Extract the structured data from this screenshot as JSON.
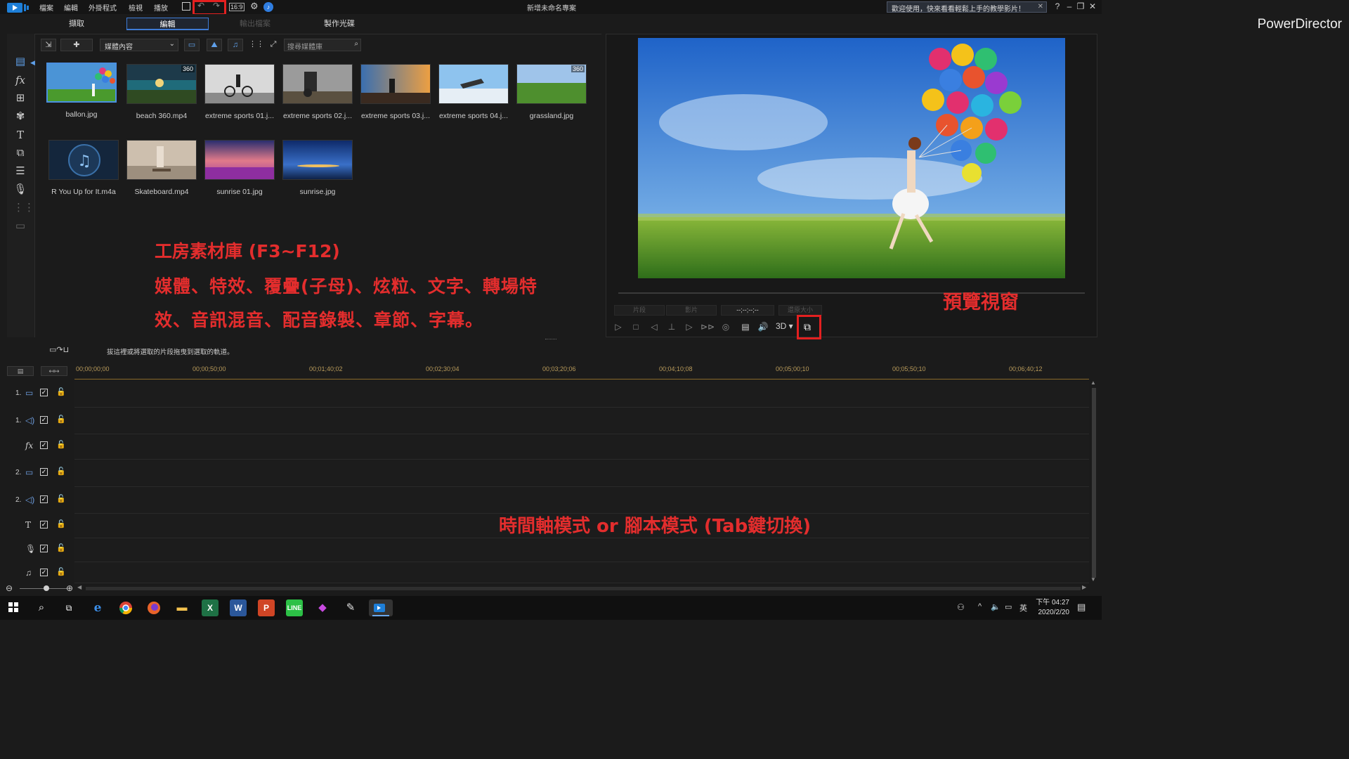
{
  "titlebar": {
    "menus": [
      "檔案",
      "編輯",
      "外掛程式",
      "檢視",
      "播放"
    ],
    "aspect": "16:9",
    "project_title": "新增未命名專案",
    "notice": "歡迎使用，快來看看輕鬆上手的教學影片！",
    "help": "?"
  },
  "modes": {
    "capture": "擷取",
    "edit": "編輯",
    "produce": "輸出檔案",
    "disc": "製作光碟"
  },
  "brand": "PowerDirector",
  "library": {
    "media_select": "媒體內容",
    "search_placeholder": "搜尋媒體庫",
    "items": [
      {
        "label": "ballon.jpg",
        "badge": ""
      },
      {
        "label": "beach 360.mp4",
        "badge": "360"
      },
      {
        "label": "extreme sports 01.j...",
        "badge": ""
      },
      {
        "label": "extreme sports 02.j...",
        "badge": ""
      },
      {
        "label": "extreme sports 03.j...",
        "badge": ""
      },
      {
        "label": "extreme sports 04.j...",
        "badge": ""
      },
      {
        "label": "grassland.jpg",
        "badge": "360"
      },
      {
        "label": "R You Up for It.m4a",
        "badge": ""
      },
      {
        "label": "Skateboard.mp4",
        "badge": ""
      },
      {
        "label": "sunrise 01.jpg",
        "badge": ""
      },
      {
        "label": "sunrise.jpg",
        "badge": ""
      }
    ]
  },
  "annotations": {
    "library_title": "工房素材庫 (F3~F12)",
    "library_line1": "媒體、特效、覆疊(子母)、炫粒、文字、轉場特",
    "library_line2": "效、音訊混音、配音錄製、章節、字幕。",
    "preview": "預覽視窗",
    "timeline": "時間軸模式 or 腳本模式 (Tab鍵切換)"
  },
  "preview": {
    "mode_clip": "片段",
    "mode_movie": "影片",
    "timecode": "--;--;--;--",
    "size": "還原大小",
    "btn_3d": "3D"
  },
  "timeline": {
    "hint": "拔這裡或將選取的片段拖曳到選取的軌道。",
    "ticks": [
      "00;00;00;00",
      "00;00;50;00",
      "00;01;40;02",
      "00;02;30;04",
      "00;03;20;06",
      "00;04;10;08",
      "00;05;00;10",
      "00;05;50;10",
      "00;06;40;12"
    ],
    "tracks": [
      {
        "num": "1.",
        "icon": "video"
      },
      {
        "num": "1.",
        "icon": "audio"
      },
      {
        "num": "",
        "icon": "fx"
      },
      {
        "num": "2.",
        "icon": "video"
      },
      {
        "num": "2.",
        "icon": "audio"
      },
      {
        "num": "",
        "icon": "title"
      },
      {
        "num": "",
        "icon": "voice"
      },
      {
        "num": "",
        "icon": "music"
      }
    ]
  },
  "taskbar": {
    "ime": "英",
    "time": "下午 04:27",
    "date": "2020/2/20"
  },
  "colors": {
    "accent": "#3e7bd6",
    "annotation_red": "#e32d2d",
    "background": "#1b1b1b"
  }
}
